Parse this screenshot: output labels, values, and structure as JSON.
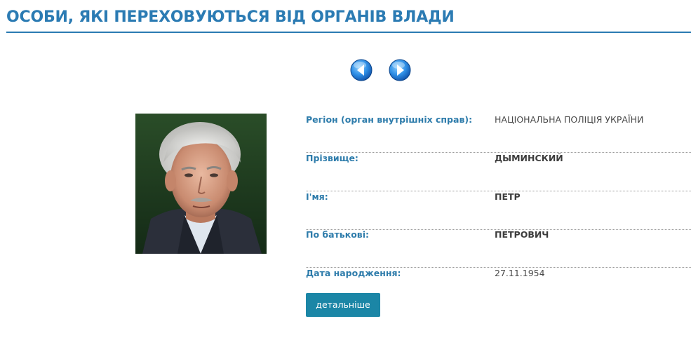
{
  "page": {
    "title": "ОСОБИ, ЯКІ ПЕРЕХОВУЮТЬСЯ ВІД ОРГАНІВ ВЛАДИ"
  },
  "navigation": {
    "prev_icon": "arrow-left-icon",
    "next_icon": "arrow-right-icon",
    "icon_color": "#1a73d1"
  },
  "person": {
    "photo_icon": "person-photo",
    "fields": {
      "region": {
        "label": "Регіон (орган внутрішніх справ):",
        "value": "НАЦІОНАЛЬНА ПОЛІЦІЯ УКРАЇНИ"
      },
      "surname": {
        "label": "Прізвище:",
        "value": "ДЫМИНСКИЙ"
      },
      "name": {
        "label": "І'мя:",
        "value": "ПЕТР"
      },
      "patronymic": {
        "label": "По батькові:",
        "value": "ПЕТРОВИЧ"
      },
      "birth_date": {
        "label": "Дата народження:",
        "value": "27.11.1954"
      }
    },
    "details_button_label": "детальніше"
  },
  "colors": {
    "accent": "#2b7bb3",
    "label": "#2e7cab",
    "button": "#1b86a6"
  }
}
